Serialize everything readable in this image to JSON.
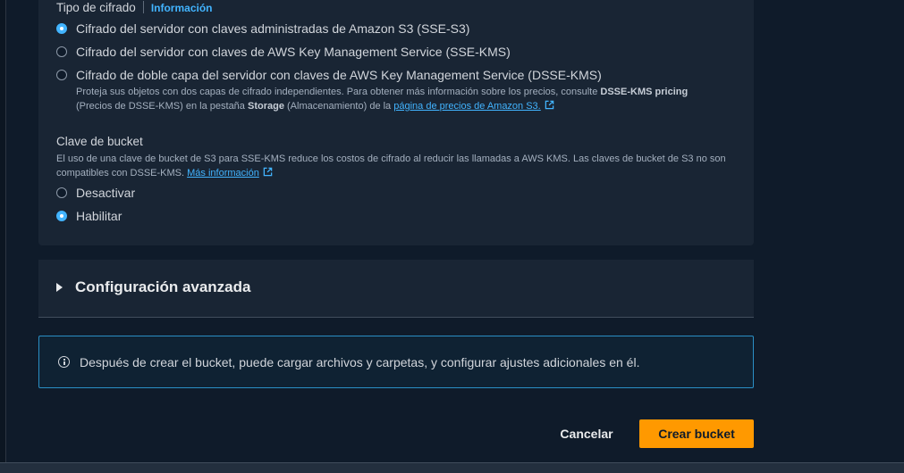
{
  "encryption": {
    "label": "Tipo de cifrado",
    "info_link": "Información",
    "options": [
      {
        "label": "Cifrado del servidor con claves administradas de Amazon S3 (SSE-S3)",
        "selected": true
      },
      {
        "label": "Cifrado del servidor con claves de AWS Key Management Service (SSE-KMS)",
        "selected": false
      },
      {
        "label": "Cifrado de doble capa del servidor con claves de AWS Key Management Service (DSSE-KMS)",
        "selected": false
      }
    ],
    "dsse_desc": {
      "part1": "Proteja sus objetos con dos capas de cifrado independientes. Para obtener más información sobre los precios, consulte ",
      "bold1": "DSSE-KMS pricing",
      "part2": " (Precios de DSSE-KMS) en la pestaña ",
      "bold2": "Storage",
      "part3": " (Almacenamiento) de la ",
      "link": "página de precios de Amazon S3."
    }
  },
  "bucket_key": {
    "label": "Clave de bucket",
    "description": "El uso de una clave de bucket de S3 para SSE-KMS reduce los costos de cifrado al reducir las llamadas a AWS KMS. Las claves de bucket de S3 no son compatibles con DSSE-KMS. ",
    "link": "Más información",
    "options": [
      {
        "label": "Desactivar",
        "selected": false
      },
      {
        "label": "Habilitar",
        "selected": true
      }
    ]
  },
  "advanced": {
    "title": "Configuración avanzada"
  },
  "alert": {
    "text": "Después de crear el bucket, puede cargar archivos y carpetas, y configurar ajustes adicionales en él."
  },
  "actions": {
    "cancel": "Cancelar",
    "create": "Crear bucket"
  },
  "colors": {
    "accent": "#42b4ff",
    "primary_button": "#ff9900",
    "background": "#0f1b2a",
    "panel": "#192534"
  }
}
